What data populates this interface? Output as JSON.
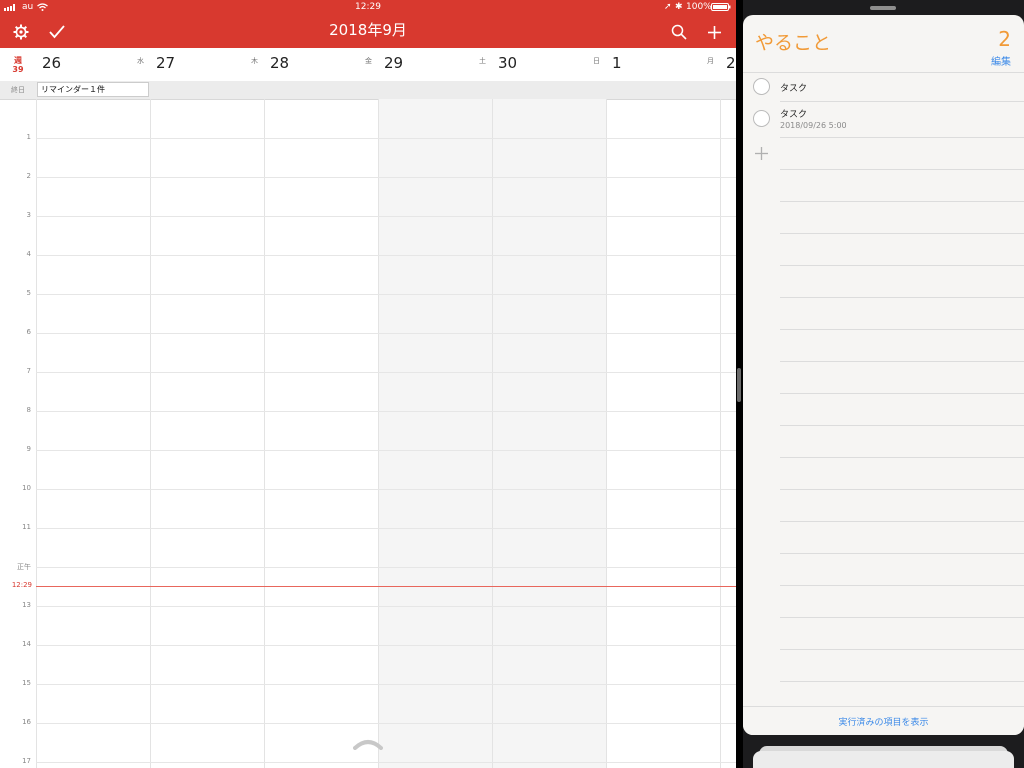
{
  "status_bar": {
    "signal": "au",
    "time": "12:29",
    "battery": "100%"
  },
  "calendar": {
    "title": "2018年9月",
    "week_label": "週",
    "week_number": "39",
    "days": [
      {
        "num": "26",
        "weekday": "水"
      },
      {
        "num": "27",
        "weekday": "木"
      },
      {
        "num": "28",
        "weekday": "金"
      },
      {
        "num": "29",
        "weekday": "土"
      },
      {
        "num": "30",
        "weekday": "日"
      },
      {
        "num": "1",
        "weekday": "月"
      },
      {
        "num": "2",
        "weekday": ""
      }
    ],
    "allday_label": "終日",
    "reminder_chip": "リマインダー１件",
    "hours": [
      "1",
      "2",
      "3",
      "4",
      "5",
      "6",
      "7",
      "8",
      "9",
      "10",
      "11",
      "正午",
      "13",
      "14",
      "15",
      "16",
      "17"
    ],
    "now_label": "12:29",
    "colors": {
      "header": "#d8392f",
      "now_line": "#e8665c"
    }
  },
  "reminders": {
    "list_title": "やること",
    "count": "2",
    "edit_label": "編集",
    "tasks": [
      {
        "name": "タスク",
        "date": ""
      },
      {
        "name": "タスク",
        "date": "2018/09/26 5:00"
      }
    ],
    "show_completed": "実行済みの項目を表示",
    "colors": {
      "accent": "#f19a37",
      "link": "#3c8ae8"
    }
  }
}
